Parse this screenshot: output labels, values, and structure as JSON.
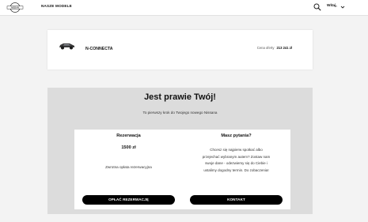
{
  "header": {
    "logo_text": "NISSAN",
    "nav_models": "NASZE MODELE",
    "greeting": "Witaj,",
    "search_icon": "search-icon",
    "user_menu_icon": "chevron-down-icon"
  },
  "model": {
    "name": "N-CONNECTA",
    "price_label": "Cena oferty",
    "price_value": "213 241 zł",
    "image_icon": "car-icon"
  },
  "checkout": {
    "title": "Jest prawie Twój!",
    "subtitle": "To pierwszy krok do Twojego nowego Nissana",
    "reservation": {
      "title": "Rezerwacja",
      "amount": "1500 zł",
      "note": "Zwrotna opłata rezerwacyjna",
      "button": "OPŁAĆ REZERWACJĘ"
    },
    "questions": {
      "title": "Masz pytania?",
      "line1": "Chcesz się najpierw spotkać albo",
      "line2": "przejechać wybranym autem? Zostaw nam",
      "line3": "swoje dane - odezwiemy się do Ciebie i",
      "line4": "ustalimy dogodny termin. Do zobaczenia!",
      "button": "KONTAKT"
    }
  },
  "colors": {
    "background": "#f3f3f3",
    "panel": "#dcdcdc",
    "button": "#000000"
  }
}
